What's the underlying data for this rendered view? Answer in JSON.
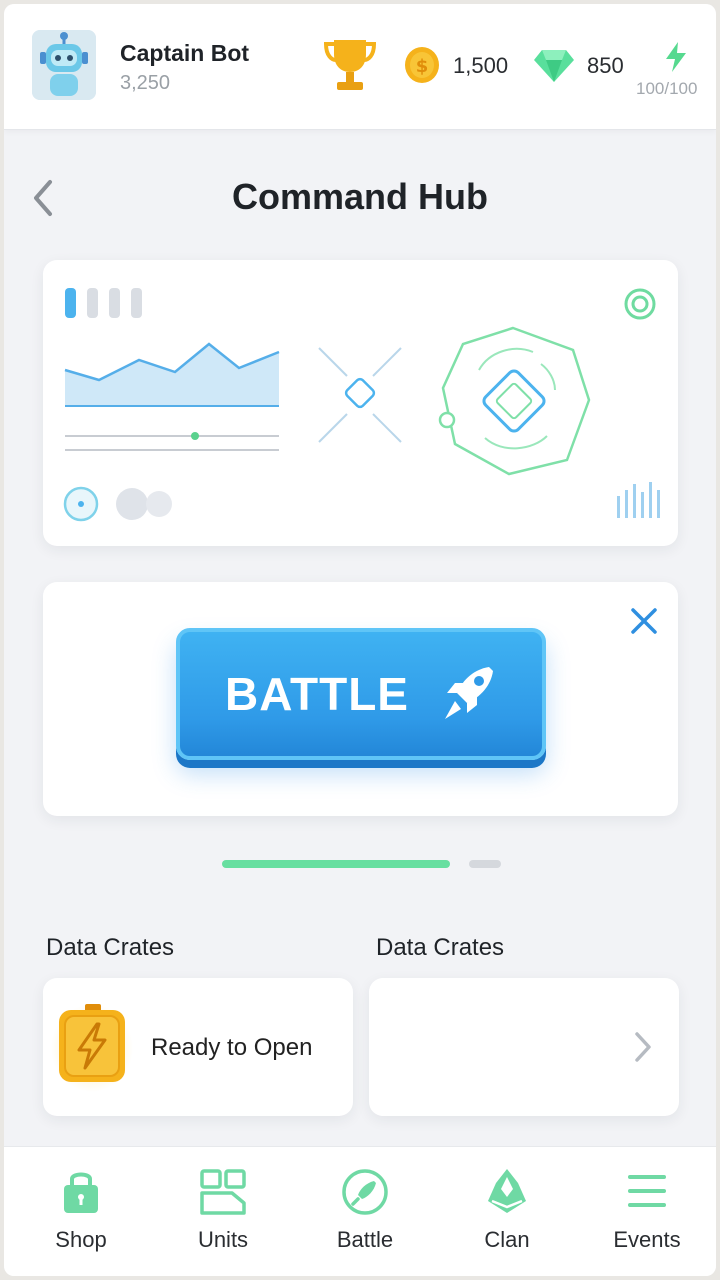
{
  "header": {
    "player_name": "Captain Bot",
    "player_score": "3,250",
    "coins": "1,500",
    "gems": "850",
    "energy": "100/100",
    "icons": [
      "robot-avatar-icon",
      "trophy-icon",
      "coin-icon",
      "gem-icon",
      "lightning-icon"
    ]
  },
  "page": {
    "title": "Command Hub"
  },
  "battle": {
    "label": "BATTLE"
  },
  "pager": {
    "active_index": 0,
    "count": 2
  },
  "crates": [
    {
      "section_label": "Data Crates",
      "status": "Ready to Open"
    },
    {
      "section_label": "Data Crates",
      "status": ""
    }
  ],
  "nav": [
    {
      "label": "Shop",
      "icon": "lock-bag-icon"
    },
    {
      "label": "Units",
      "icon": "grid-icon"
    },
    {
      "label": "Battle",
      "icon": "rocket-icon"
    },
    {
      "label": "Clan",
      "icon": "clan-ship-icon"
    },
    {
      "label": "Events",
      "icon": "list-icon"
    }
  ],
  "colors": {
    "accent_blue": "#2f9ae8",
    "accent_green": "#67dfa0",
    "gold": "#f5b21b"
  }
}
